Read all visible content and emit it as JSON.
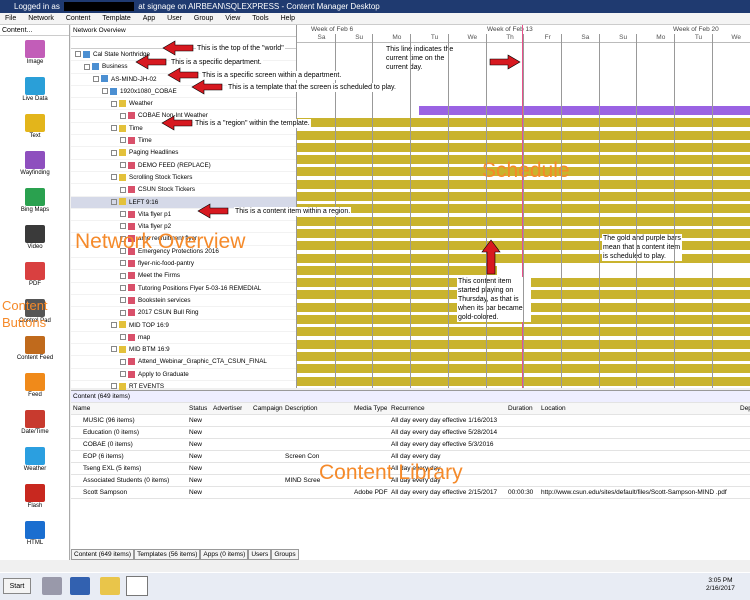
{
  "title": {
    "prefix": "Logged in as",
    "suffix": "at signage on AIRBEAN\\SQLEXPRESS - Content Manager Desktop"
  },
  "menu": [
    "File",
    "Network",
    "Content",
    "Template",
    "App",
    "User",
    "Group",
    "View",
    "Tools",
    "Help"
  ],
  "sidebar": {
    "header": "Content...",
    "items": [
      {
        "label": "Image",
        "color": "#c25db8"
      },
      {
        "label": "Live Data",
        "color": "#2a9fd8"
      },
      {
        "label": "Text",
        "color": "#e3b51b"
      },
      {
        "label": "Wayfinding",
        "color": "#8e4fbe"
      },
      {
        "label": "Bing Maps",
        "color": "#2aa14f"
      },
      {
        "label": "Video",
        "color": "#3a3a3a"
      },
      {
        "label": "PDF",
        "color": "#d94040"
      },
      {
        "label": "Control Pad",
        "color": "#555555"
      },
      {
        "label": "Content Feed",
        "color": "#c06a1c"
      },
      {
        "label": "Feed",
        "color": "#f08a1a"
      },
      {
        "label": "Date/Time",
        "color": "#c83a2e"
      },
      {
        "label": "Weather",
        "color": "#2b9fe0"
      },
      {
        "label": "Flash",
        "color": "#c8281f"
      },
      {
        "label": "HTML",
        "color": "#1a6ed0"
      }
    ],
    "overlay": "Content\nButtons"
  },
  "network": {
    "header": "Network Overview",
    "rows": [
      {
        "label": "Cal State Northridge",
        "indent": 0,
        "sel": false
      },
      {
        "label": "Business",
        "indent": 1,
        "sel": false
      },
      {
        "label": "AS-MIND-JH-02",
        "indent": 2,
        "sel": false
      },
      {
        "label": "1920x1080_COBAE",
        "indent": 3,
        "sel": false
      },
      {
        "label": "Weather",
        "indent": 4,
        "sel": false
      },
      {
        "label": "COBAE Non-Int Weather",
        "indent": 5,
        "sel": false
      },
      {
        "label": "Time",
        "indent": 4,
        "sel": false
      },
      {
        "label": "Time",
        "indent": 5,
        "sel": false
      },
      {
        "label": "Paging Headlines",
        "indent": 4,
        "sel": false
      },
      {
        "label": "DEMO FEED (REPLACE)",
        "indent": 5,
        "sel": false
      },
      {
        "label": "Scrolling Stock Tickers",
        "indent": 4,
        "sel": false
      },
      {
        "label": "CSUN Stock Tickers",
        "indent": 5,
        "sel": false
      },
      {
        "label": "LEFT 9:16",
        "indent": 4,
        "sel": true
      },
      {
        "label": "Vita flyer p1",
        "indent": 5,
        "sel": false
      },
      {
        "label": "Vita flyer p2",
        "indent": 5,
        "sel": false
      },
      {
        "label": "amp recruitment flyer",
        "indent": 5,
        "sel": false
      },
      {
        "label": "Emergency Protections 2016",
        "indent": 5,
        "sel": false
      },
      {
        "label": "flyer-nic-food-pantry",
        "indent": 5,
        "sel": false
      },
      {
        "label": "Meet the Firms",
        "indent": 5,
        "sel": false
      },
      {
        "label": "Tutoring Positions Flyer 5-03-16 REMEDIAL",
        "indent": 5,
        "sel": false
      },
      {
        "label": "Bookstein services",
        "indent": 5,
        "sel": false
      },
      {
        "label": "2017 CSUN Bull Ring",
        "indent": 5,
        "sel": false
      },
      {
        "label": "MID TOP 16:9",
        "indent": 4,
        "sel": false
      },
      {
        "label": "map",
        "indent": 5,
        "sel": false
      },
      {
        "label": "MID BTM 16:9",
        "indent": 4,
        "sel": false
      },
      {
        "label": "Attend_Webinar_Graphic_CTA_CSUN_FINAL",
        "indent": 5,
        "sel": false
      },
      {
        "label": "Apply to Graduate",
        "indent": 5,
        "sel": false
      },
      {
        "label": "RT EVENTS",
        "indent": 4,
        "sel": false
      }
    ],
    "overlay": "Network Overview"
  },
  "schedule": {
    "weeks": [
      "Week of Feb 6",
      "Week of Feb 13",
      "Week of Feb 20"
    ],
    "days": [
      "Sa",
      "Su",
      "Mo",
      "Tu",
      "We",
      "Th",
      "Fr",
      "Sa",
      "Su",
      "Mo",
      "Tu",
      "We"
    ],
    "overlay": "Schedule"
  },
  "annotations": {
    "a1": "This is the top of the \"world\"",
    "a2": "This is a specific department.",
    "a3": "This is a specific screen within a department.",
    "a4": "This is a template that the screen is scheduled to play.",
    "a5": "This is a \"region\" within the template.",
    "a6": "This is a content item within a region.",
    "a7": "This line indicates the current time on the current day.",
    "a8": "This content item started playing on Thursday, as that is when its bar became gold-colored.",
    "a9": "The gold and purple bars mean that a content item is scheduled to play."
  },
  "library": {
    "header": "Content (649 items)",
    "columns": [
      "Name",
      "Status",
      "Advertiser",
      "Campaign",
      "Description",
      "Media Type",
      "Recurrence",
      "Duration",
      "Location",
      "Dep"
    ],
    "rows": [
      {
        "name": "MUSIC (96 items)",
        "status": "New",
        "desc": "",
        "media": "",
        "rec": "All day every day effective 1/16/2013",
        "dur": "",
        "loc": ""
      },
      {
        "name": "Education (0 items)",
        "status": "New",
        "desc": "",
        "media": "",
        "rec": "All day every day effective 5/28/2014",
        "dur": "",
        "loc": ""
      },
      {
        "name": "COBAE (0 items)",
        "status": "New",
        "desc": "",
        "media": "",
        "rec": "All day every day effective 5/3/2016",
        "dur": "",
        "loc": ""
      },
      {
        "name": "EOP (6 items)",
        "status": "New",
        "desc": "Screen Con",
        "media": "",
        "rec": "All day every day",
        "dur": "",
        "loc": ""
      },
      {
        "name": "Tseng EXL (5 items)",
        "status": "New",
        "desc": "",
        "media": "",
        "rec": "All day every day",
        "dur": "",
        "loc": ""
      },
      {
        "name": "Associated Students (0 items)",
        "status": "New",
        "desc": "MIND Scree",
        "media": "",
        "rec": "All day every day",
        "dur": "",
        "loc": ""
      },
      {
        "name": "Scott Sampson",
        "status": "New",
        "desc": "",
        "media": "Adobe PDF",
        "rec": "All day every day effective 2/15/2017",
        "dur": "00:00:30",
        "loc": "http://www.csun.edu/sites/default/files/Scott-Sampson-MIND .pdf"
      }
    ],
    "tabs": [
      "Content (649 items)",
      "Templates (56 items)",
      "Apps (0 items)",
      "Users",
      "Groups"
    ],
    "overlay": "Content Library"
  },
  "taskbar": {
    "start": "Start",
    "time": "3:05 PM",
    "date": "2/16/2017"
  }
}
